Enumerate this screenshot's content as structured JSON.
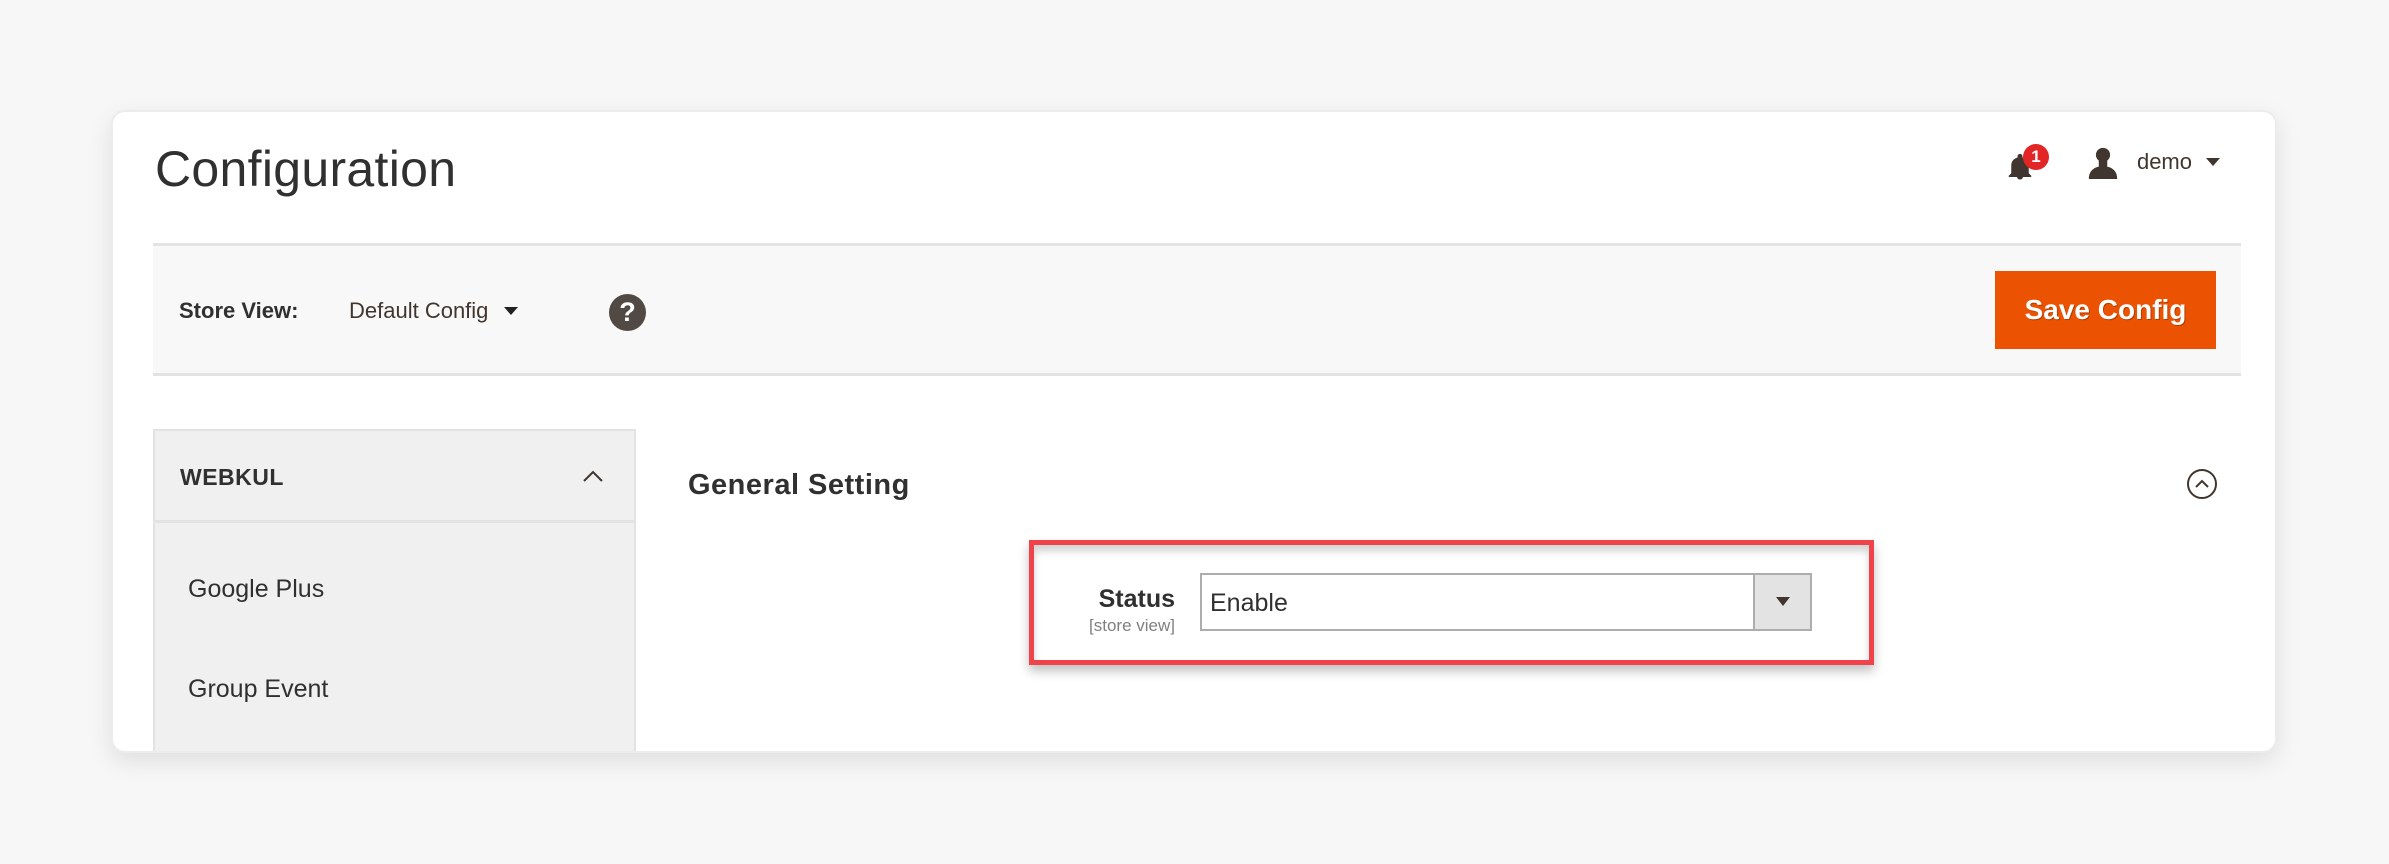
{
  "header": {
    "title": "Configuration",
    "notifications": {
      "icon": "bell-icon",
      "count": "1",
      "badge_color": "#e22626"
    },
    "user": {
      "icon": "user-icon",
      "name": "demo"
    }
  },
  "toolbar": {
    "store_view_label": "Store View:",
    "store_view_value": "Default Config",
    "help_icon": "?",
    "save_label": "Save Config",
    "save_color": "#eb5202"
  },
  "sidebar": {
    "section_title": "WEBKUL",
    "expanded": true,
    "items": [
      {
        "label": "Google Plus"
      },
      {
        "label": "Group Event"
      }
    ]
  },
  "main": {
    "section_title": "General Setting",
    "expanded": true,
    "fields": [
      {
        "label": "Status",
        "scope": "[store view]",
        "value": "Enable"
      }
    ],
    "highlight_color": "#f0424a"
  }
}
